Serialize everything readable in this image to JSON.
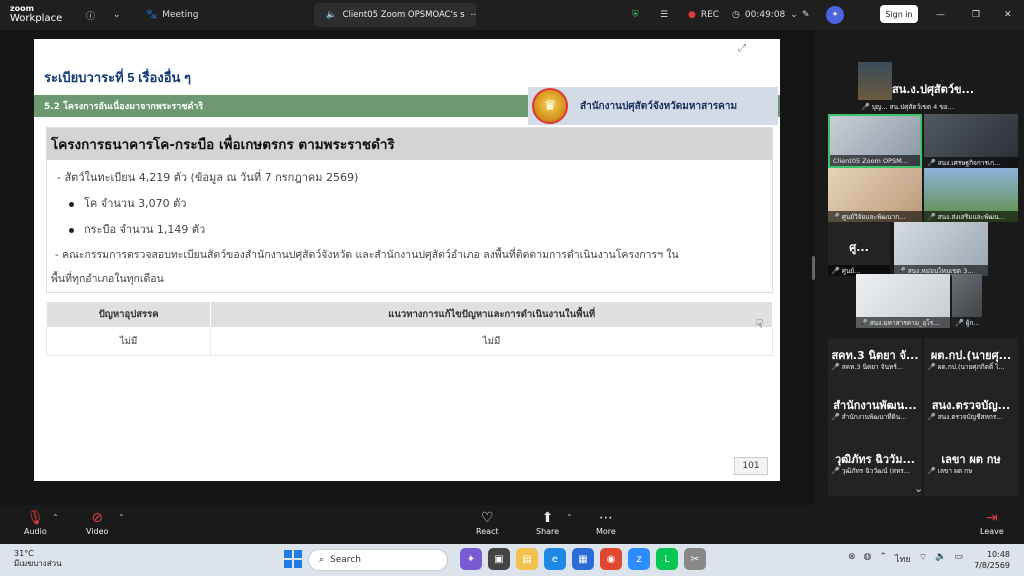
{
  "app": {
    "logo_line1": "zoom",
    "logo_line2": "Workplace"
  },
  "topbar": {
    "meeting_label": "Meeting",
    "tab_title": "Client05 Zoom OPSMOAC's s",
    "rec_label": "REC",
    "timer": "00:49:08",
    "signin_label": "Sign in"
  },
  "slide": {
    "title": "ระเบียบวาระที่ 5 เรื่องอื่น ๆ",
    "subtitle": "5.2 โครงการอันเนื่องมาจากพระราชดำริ",
    "office": "สำนักงานปศุสัตว์จังหวัดมหาสารคาม",
    "heading": "โครงการธนาคารโค-กระบือ เพื่อเกษตรกร ตามพระราชดำริ",
    "lines": {
      "l1": "- สัตว์ในทะเบียน 4,219 ตัว (ข้อมูล ณ วันที่ 7 กรกฎาคม 2569)",
      "l2": "โค จำนวน 3,070 ตัว",
      "l3": "กระบือ จำนวน 1,149 ตัว",
      "l4": "- คณะกรรมการตรวจสอบทะเบียนสัตว์ของสำนักงานปศุสัตว์จังหวัด และสำนักงานปศุสัตว์อำเภอ ลงพื้นที่ติดตามการดำเนินงานโครงการฯ ใน",
      "l5": "พื้นที่ทุกอำเภอในทุกเดือน"
    },
    "table": {
      "col1": "ปัญหาอุปสรรค",
      "col2": "แนวทางการแก้ไขปัญหาและการดำเนินงานในพื้นที่",
      "val1": "ไม่มี",
      "val2": "ไม่มี"
    },
    "page_number": "101"
  },
  "gallery": {
    "t1_big": "สน.ง.ปศุสัตว์ข...",
    "t1_name": "บุญ... สน.ปศุสัตว์เขต 4 ขอ...",
    "t2_name": "Client05 Zoom OPSM...",
    "t3_name": "สนง.เศรษฐกิจการเก...",
    "t4_name": "ศูนย์วิจัยและพัฒนาก...",
    "t5_name": "สนง.ส่งเสริมและพัฒน...",
    "t6_big": "ศู...",
    "t6_name": "ศูนย์...",
    "t7_name": "สนง.หม่อนไหมเขต 3...",
    "t8_name": "สนง.มหาสารคาม_อุโร...",
    "t9_name": "ผู้ก...",
    "t10_big": "สคท.3 นิตยา จั...",
    "t10_name": "สคท.3 นิตยา จันทร์...",
    "t11_big": "ผต.กป.(นายศุ...",
    "t11_name": "ผต.กป.(นายศุภกิตติ์ ไ...",
    "t12_big": "สำนักงานพัฒน...",
    "t12_name": "สำนักงานพัฒนาที่ดิน...",
    "t13_big": "สนง.ตรวจบัญ...",
    "t13_name": "สนง.ตรวจบัญชีสหกร...",
    "t14_big": "วุฒิภัทร ฉิววัม...",
    "t14_name": "วุฒิภัทร ฉิววัฒน์ (สหร...",
    "t15_big": "เลขา ผต กษ",
    "t15_name": "เลขา ผต กษ"
  },
  "controls": {
    "audio": "Audio",
    "video": "Video",
    "react": "React",
    "share": "Share",
    "more": "More",
    "leave": "Leave"
  },
  "taskbar": {
    "temp": "31°C",
    "weather": "มีเมฆบางส่วน",
    "search": "Search",
    "lang": "ไทย",
    "time": "10:48",
    "date": "7/8/2569"
  },
  "colors": {
    "band_green": "#6c9972",
    "title_blue": "#163b74",
    "rec_red": "#e03b3b"
  }
}
